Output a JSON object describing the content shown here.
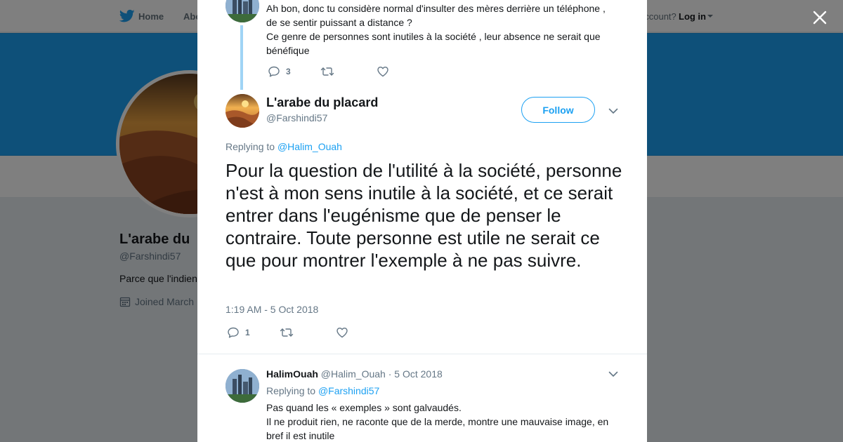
{
  "nav": {
    "home_label": "Home",
    "about_label": "Abo",
    "account_prompt": "account?",
    "login_label": "Log in"
  },
  "profile": {
    "name": "L'arabe du",
    "handle": "@Farshindi57",
    "bio": "Parce que l'indien",
    "joined": "Joined March"
  },
  "thread": {
    "previous_tweet": {
      "lines": [
        "Ah bon, donc tu considère normal d'insulter des mères derrière un téléphone , de se sentir puissant a distance ?",
        "Ce genre de personnes sont inutiles à la société , leur absence ne serait que bénéfique"
      ],
      "reply_count": "3"
    },
    "main_tweet": {
      "name": "L'arabe du placard",
      "handle": "@Farshindi57",
      "follow_label": "Follow",
      "replying_prefix": "Replying to",
      "replying_handle": "@Halim_Ouah",
      "text": "Pour la question de l'utilité à la société, personne n'est à mon sens inutile à la société, et ce serait entrer dans l'eugénisme que de penser le contraire. Toute personne est utile ne serait ce que pour montrer l'exemple à ne pas suivre.",
      "timestamp": "1:19 AM - 5 Oct 2018",
      "reply_count": "1"
    },
    "reply": {
      "name": "HalimOuah",
      "handle": "@Halim_Ouah",
      "date": "· 5 Oct 2018",
      "replying_prefix": "Replying to",
      "replying_handle": "@Farshindi57",
      "lines": [
        "Pas quand les « exemples » sont galvaudés.",
        "Il ne produit rien, ne raconte que de la merde, montre une mauvaise image, en bref il est inutile"
      ]
    }
  },
  "colors": {
    "accent": "#1da1f2",
    "banner": "#1da1f2",
    "thread_line": "#9fd4f5",
    "text_primary": "#14171a",
    "text_secondary": "#657786"
  },
  "icons": {
    "logo": "twitter-bird-icon",
    "close": "close-icon",
    "reply": "reply-icon",
    "retweet": "retweet-icon",
    "like": "heart-icon",
    "caret": "chevron-down-icon",
    "calendar": "calendar-icon"
  }
}
